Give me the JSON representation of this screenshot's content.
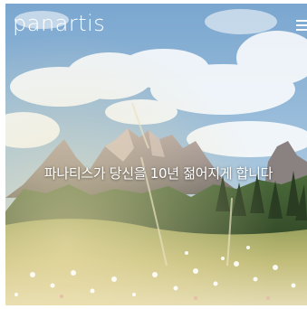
{
  "header": {
    "logo_text": "panartis",
    "menu_icon": "hamburger-menu-icon"
  },
  "hero": {
    "tagline": "파나티스가 당신을 10년 젊어지게 합니다",
    "scene": "mountain-meadow-photo"
  },
  "colors": {
    "text": "#ffffff",
    "sky": "#8fb2cf",
    "forest": "#3f5a33",
    "meadow": "#c9c07e"
  }
}
